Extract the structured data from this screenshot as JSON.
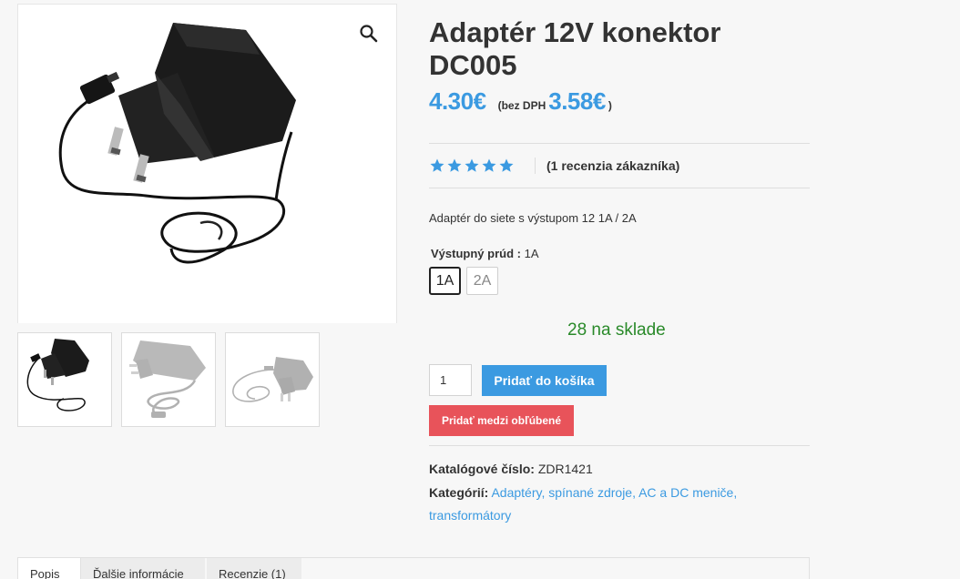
{
  "product": {
    "title": "Adaptér 12V konektor DC005",
    "price": "4.30€",
    "vat_note": "(bez DPH",
    "price_without_vat": "3.58€",
    "vat_close": ")",
    "rating": 5,
    "reviews_link": "(1 recenzia zákazníka)",
    "description": "Adaptér do siete s výstupom 12 1A / 2A",
    "variation": {
      "label": "Výstupný prúd",
      "separator": ":",
      "selected_value": "1A",
      "options": [
        "1A",
        "2A"
      ]
    },
    "stock": "28 na sklade",
    "quantity": "1",
    "add_to_cart": "Pridať do košíka",
    "wishlist": "Pridať medzi obľúbené",
    "meta": {
      "sku_label": "Katalógové číslo:",
      "sku_value": "ZDR1421",
      "categories_label": "Kategórií:",
      "category_link_1": "Adaptéry, spínané zdroje, AC a DC meniče,",
      "category_link_2": "transformátory"
    }
  },
  "gallery": {
    "zoom_icon": "magnifier-icon",
    "thumbnails": 3
  },
  "tabs": [
    "Popis",
    "Ďalšie informácie",
    "Recenzie (1)"
  ],
  "colors": {
    "accent_blue": "#3b9ae1",
    "wishlist_red": "#e8535a",
    "stock_green": "#2a8a2a",
    "star_blue": "#3b9ae1"
  }
}
